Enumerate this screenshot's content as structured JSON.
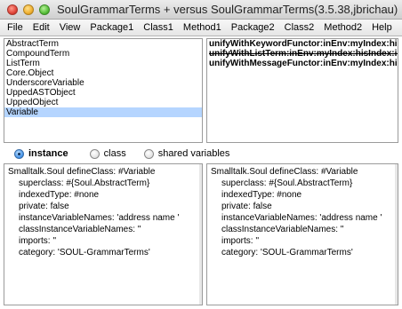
{
  "window": {
    "title": "SoulGrammarTerms + versus SoulGrammarTerms(3.5.38,jbrichau)"
  },
  "menu": {
    "items": [
      "File",
      "Edit",
      "View",
      "Package1",
      "Class1",
      "Method1",
      "Package2",
      "Class2",
      "Method2",
      "Help"
    ]
  },
  "class_list": {
    "items": [
      "AbstractTerm",
      "CompoundTerm",
      "ListTerm",
      "Core.Object",
      "UnderscoreVariable",
      "UppedASTObject",
      "UppedObject",
      "Variable"
    ],
    "selected": "Variable"
  },
  "method_list": {
    "items": [
      {
        "label": "unifyWithKeywordFunctor:inEnv:myIndex:his",
        "struck": false
      },
      {
        "label": "unifyWithListTerm:inEnv:myIndex:hisIndex:in",
        "struck": true
      },
      {
        "label": "unifyWithMessageFunctor:inEnv:myIndex:his",
        "struck": false
      }
    ]
  },
  "radio": {
    "instance": "instance",
    "class": "class",
    "shared": "shared variables",
    "selected": "instance"
  },
  "definition_left": {
    "line1": "Smalltalk.Soul defineClass: #Variable",
    "line2": "superclass: #{Soul.AbstractTerm}",
    "line3": "indexedType: #none",
    "line4": "private: false",
    "line5": "instanceVariableNames: 'address name '",
    "line6": "classInstanceVariableNames: ''",
    "line7": "imports: ''",
    "line8": "category: 'SOUL-GrammarTerms'"
  },
  "definition_right": {
    "line1": "Smalltalk.Soul defineClass: #Variable",
    "line2": "superclass: #{Soul.AbstractTerm}",
    "line3": "indexedType: #none",
    "line4": "private: false",
    "line5": "instanceVariableNames: 'address name '",
    "line6": "classInstanceVariableNames: ''",
    "line7": "imports: ''",
    "line8": "category: 'SOUL-GrammarTerms'"
  }
}
